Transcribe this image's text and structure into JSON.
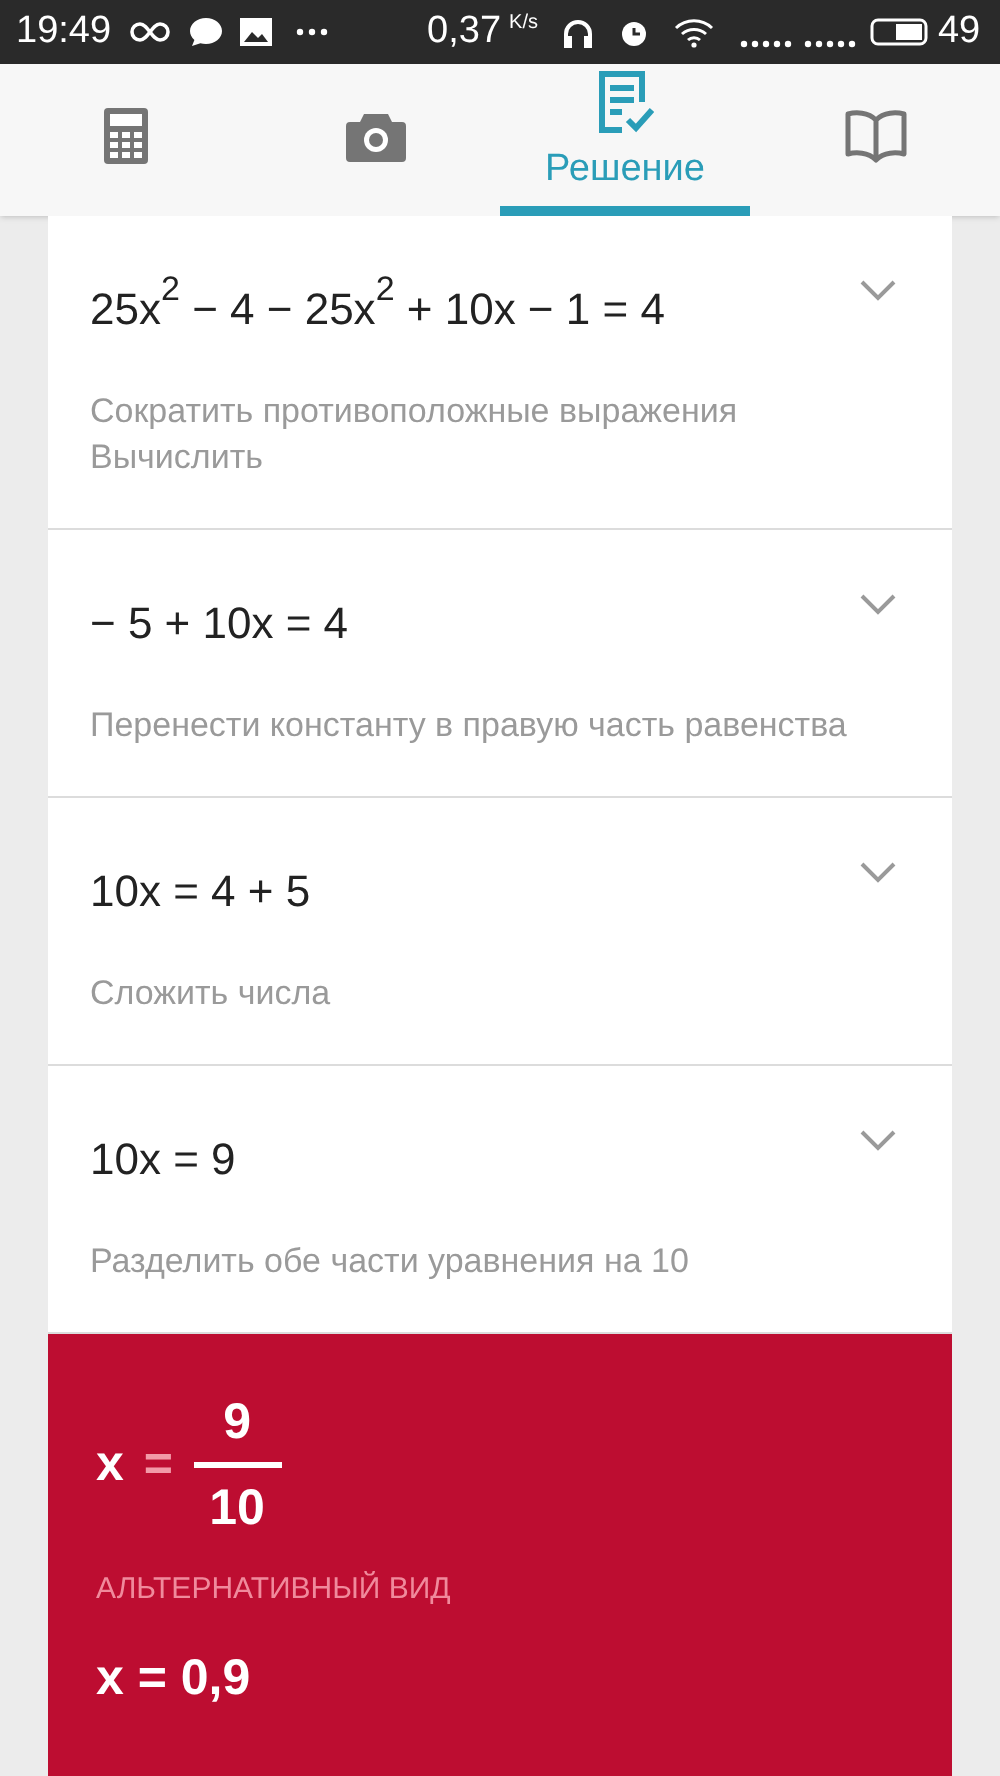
{
  "status_bar": {
    "time": "19:49",
    "speed": "0,37",
    "speed_unit": "K/s",
    "battery": "49"
  },
  "tabs": [
    {
      "kind": "calculator",
      "selected": false
    },
    {
      "kind": "camera",
      "selected": false
    },
    {
      "kind": "solution",
      "label": "Решение",
      "selected": true
    },
    {
      "kind": "book",
      "selected": false
    }
  ],
  "steps": [
    {
      "equation": "25x$^{2}$ − 4 − 25x$^{2}$ + 10x − 1 = 4",
      "description": [
        "Сократить противоположные выражения",
        "Вычислить"
      ]
    },
    {
      "equation": "− 5 + 10x = 4",
      "description": [
        "Перенести константу в правую часть равенства"
      ]
    },
    {
      "equation": "10x = 4 + 5",
      "description": [
        "Сложить числа"
      ]
    },
    {
      "equation": "10x = 9",
      "description": [
        "Разделить обе части уравнения на 10"
      ]
    }
  ],
  "result": {
    "variable": "x",
    "equals": "=",
    "numerator": "9",
    "denominator": "10",
    "alternative_label": "АЛЬТЕРНАТИВНЫЙ ВИД",
    "alternative_value": "x = 0,9"
  }
}
